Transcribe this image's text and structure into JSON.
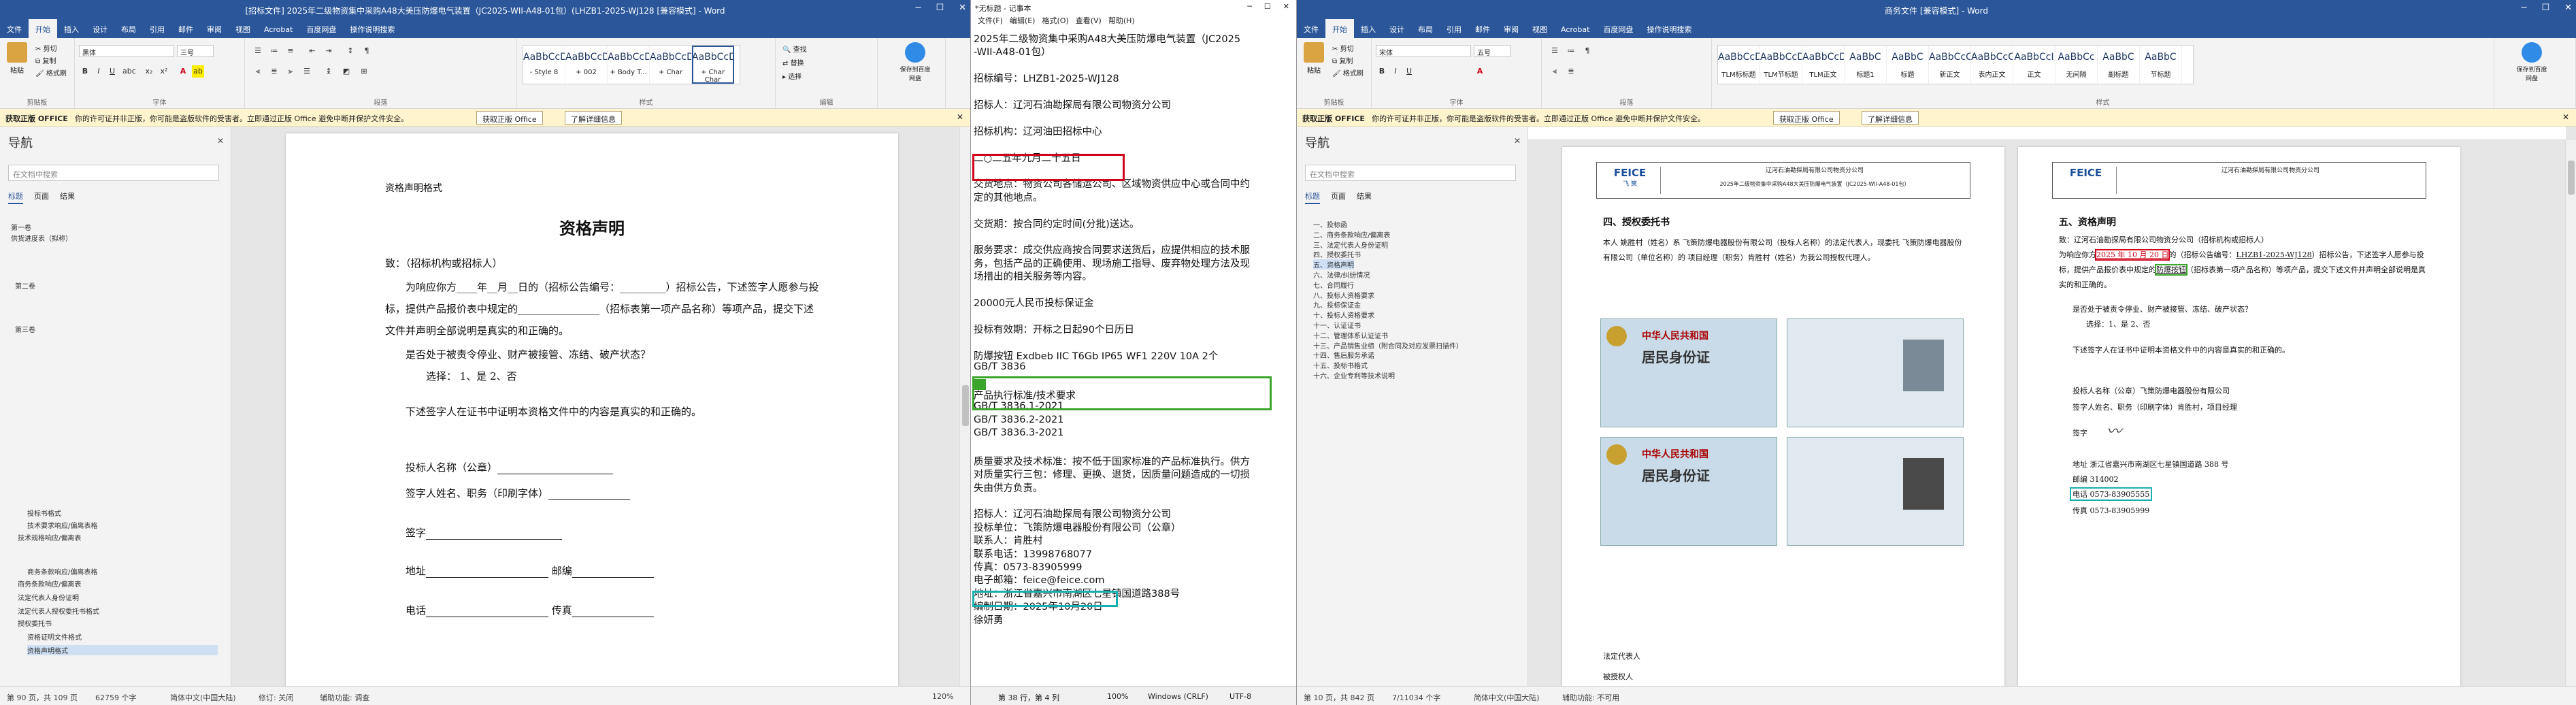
{
  "left_window": {
    "title": "[招标文件] 2025年二级物资集中采购A48大美压防爆电气装置（JC2025-WII-A48-01包）(LHZB1-2025-WJ128 [兼容模式] - Word",
    "tabs": [
      "文件",
      "开始",
      "插入",
      "设计",
      "布局",
      "引用",
      "邮件",
      "审阅",
      "视图",
      "Acrobat",
      "百度网盘",
      "操作说明搜索"
    ],
    "active_tab": "开始",
    "ribbon": {
      "paste": "粘贴",
      "cut": "剪切",
      "copy": "复制",
      "format_painter": "格式刷",
      "clipboard_group": "剪贴板",
      "font_name": "黑体",
      "font_size": "三号",
      "font_group": "字体",
      "paragraph_group": "段落",
      "styles_group": "样式",
      "styles": [
        {
          "preview": "AaBbCcDd",
          "name": "- Style 8"
        },
        {
          "preview": "AaBbCcDd",
          "name": "+ 002"
        },
        {
          "preview": "AaBbCcDd",
          "name": "+ Body T..."
        },
        {
          "preview": "AaBbCcDd",
          "name": "+ Char"
        },
        {
          "preview": "AaBbCcDd",
          "name": "+ Char Char"
        }
      ],
      "find": "查找",
      "replace": "替换",
      "select": "选择",
      "editing_group": "编辑",
      "save_baidu": "保存到百度网盘",
      "save_group": "保存"
    },
    "infobar": {
      "title": "获取正版 OFFICE",
      "message": "你的许可证并非正版，你可能是盗版软件的受害者。立即通过正版 Office 避免中断并保护文件安全。",
      "btn1": "获取正版 Office",
      "btn2": "了解详细信息"
    },
    "nav": {
      "title": "导航",
      "search_placeholder": "在文档中搜索",
      "tabs": [
        "标题",
        "页面",
        "结果"
      ],
      "items": [
        "第一卷",
        "供货进度表（拟称）",
        "第二卷",
        "第三卷",
        "投标书格式",
        "技术要求响应/偏离表格",
        "技术规格响应/偏离表",
        "商务条款响应/偏离表格",
        "商务条款响应/偏离表",
        "法定代表人身份证明",
        "法定代表人授权委托书格式",
        "授权委托书",
        "资格证明文件格式",
        "资格声明格式"
      ]
    },
    "document": {
      "section_label": "资格声明格式",
      "heading": "资格声明",
      "salutation": "致：（招标机构或招标人）",
      "para1": "为响应你方____年__月__日的（招标公告编号：_________）招标公告，下述签字人愿参与投标，提供产品报价表中规定的________________（招标表第一项产品名称）等项产品，提交下述文件并声明全部说明是真实的和正确的。",
      "q1": "是否处于被责令停业、财产被接管、冻结、破产状态？",
      "q1_options": "选择：  1、是          2、否",
      "para2": "下述签字人在证书中证明本资格文件中的内容是真实的和正确的。",
      "f1": "投标人名称（公章）",
      "f2": "签字人姓名、职务（印刷字体）",
      "f3": "签字",
      "f4": "地址",
      "f4b": "邮编",
      "f5": "电话",
      "f5b": "传真"
    },
    "status": {
      "page": "第 90 页，共 109 页",
      "words": "62759 个字",
      "lang": "简体中文(中国大陆)",
      "modify": "修订: 关闭",
      "a11y": "辅助功能: 调查",
      "zoom": "120%"
    }
  },
  "notepad": {
    "title": "*无标题 - 记事本",
    "menu": [
      "文件(F)",
      "编辑(E)",
      "格式(O)",
      "查看(V)",
      "帮助(H)"
    ],
    "lines": [
      "2025年二级物资集中采购A48大美压防爆电气装置（JC2025",
      "-WII-A48-01包）",
      "",
      "招标编号：LHZB1-2025-WJ128",
      "",
      "招标人：辽河石油勘探局有限公司物资分公司",
      "",
      "招标机构：辽河油田招标中心",
      "",
      "二○二五年九月二十五日",
      "",
      "交货地点：物资公司各储运公司、区域物资供应中心或合同中约",
      "定的其他地点。",
      "",
      "交货期：按合同约定时间(分批)送达。",
      "",
      "服务要求：成交供应商按合同要求送货后，应提供相应的技术服",
      "务，包括产品的正确使用、现场施工指导、废弃物处理方法及现",
      "场措出的相关服务等内容。",
      "",
      "20000元人民币投标保证金",
      "",
      "投标有效期：开标之日起90个日历日",
      "",
      "    防爆按钮 Exdbeb IIC T6Gb IP65 WF1 220V 10A 2个",
      "GB/T 3836",
      "",
      "产品执行标准/技术要求",
      "GB/T 3836.1-2021",
      "GB/T 3836.2-2021",
      "GB/T 3836.3-2021",
      "",
      "质量要求及技术标准：按不低于国家标准的产品标准执行。供方",
      "对质量实行三包：修理、更换、退货，因质量问题造成的一切损",
      "失由供方负责。",
      "",
      "招标人：辽河石油勘探局有限公司物资分公司",
      "投标单位：飞策防爆电器股份有限公司（公章）",
      "联系人：肯胜村",
      "联系电话：13998768077",
      "传真：0573-83905999",
      "电子邮箱：feice@feice.com",
      "地址：浙江省嘉兴市南湖区七星镇国道路388号",
      "编制日期：2025年10月20日",
      "徐妍勇"
    ],
    "status": {
      "pos": "第 38 行，第 4 列",
      "zoom": "100%",
      "eol": "Windows (CRLF)",
      "enc": "UTF-8"
    }
  },
  "right_window": {
    "title": "商务文件 [兼容模式] - Word",
    "tabs": [
      "文件",
      "开始",
      "插入",
      "设计",
      "布局",
      "引用",
      "邮件",
      "审阅",
      "视图",
      "Acrobat",
      "百度网盘",
      "操作说明搜索"
    ],
    "active_tab": "开始",
    "ribbon": {
      "font_name": "宋体",
      "font_size": "五号",
      "styles": [
        {
          "preview": "AaBbCcDd",
          "name": "TLM标标题"
        },
        {
          "preview": "AaBbCcDd",
          "name": "TLM节标题"
        },
        {
          "preview": "AaBbCcDd",
          "name": "TLM正文"
        },
        {
          "preview": "AaBbC",
          "name": "标题1"
        },
        {
          "preview": "AaBbC",
          "name": "标题"
        },
        {
          "preview": "AaBbCcC",
          "name": "新正文"
        },
        {
          "preview": "AaBbCcC",
          "name": "表内正文"
        },
        {
          "preview": "AaBbCcI",
          "name": "正文"
        },
        {
          "preview": "AaBbCc",
          "name": "无间隔"
        },
        {
          "preview": "AaBbC",
          "name": "副标题"
        },
        {
          "preview": "AaBbC",
          "name": "节标题"
        }
      ]
    },
    "nav": {
      "title": "导航",
      "search_placeholder": "在文档中搜索",
      "tabs": [
        "标题",
        "页面",
        "结果"
      ],
      "items": [
        "一、投标函",
        "二、商务条款响应/偏离表",
        "三、法定代表人身份证明",
        "四、授权委托书",
        "五、资格声明",
        "六、法律/纠纷情况",
        "七、合同履行",
        "八、投标人资格要求",
        "九、投标保证金",
        "十、投标人资格要求",
        "十一、认证证书",
        "十二、管理体系认证证书",
        "十三、产品销售业绩（附合同及对应发票扫描件）",
        "十四、售后服务承诺",
        "十五、投标书格式",
        "十六、企业专利等技术说明"
      ]
    },
    "page_left": {
      "company_header": "辽河石油勘探局有限公司物资分公司",
      "project": "2025年二级物资集中采购A48大美压防爆电气装置（JC2025-WII-A48-01包）",
      "logo": "FEICE",
      "logo_sub": "飞 策",
      "heading": "四、授权委托书",
      "body": "本人 姚胜村（姓名）系 飞策防爆电器股份有限公司（投标人名称）的法定代表人，现委托 飞策防爆电器股份有限公司（单位名称）的 项目经理（职务）肯胜村（姓名）为我公司授权代理人。",
      "agent_sign": "法定代表人",
      "agent_sign2": "被授权人",
      "id_title": "中华人民共和国",
      "id_name": "居民身份证"
    },
    "page_right": {
      "company_header": "辽河石油勘探局有限公司物资分公司",
      "logo": "FEICE",
      "heading": "五、资格声明",
      "salutation": "致：辽河石油勘探局有限公司物资分公司（招标机构或招标人）",
      "para1a": "为响应你方",
      "date_hl": "2025 年 10 月 20 日",
      "para1b": "的（招标公告编号：",
      "code": "LHZB1-2025-WJ128",
      "para1c": "）招标公告，下述签字人愿参与投标，提供产品报价表中规定的",
      "product_hl": "防爆按钮",
      "para1d": "（招标表第一项产品名称）等项产品，提交下述文件并声明全部说明是真实的和正确的。",
      "q1": "是否处于被责令停业、财产被接管、冻结、破产状态？",
      "q1_options": "选择：1、是  2、否",
      "para2": "下述签字人在证书中证明本资格文件中的内容是真实的和正确的。",
      "f1": "投标人名称（公章）飞策防爆电器股份有限公司",
      "f2": "签字人姓名、职务（印刷字体）肯胜村，项目经理",
      "f3": "签字",
      "f4": "地址  浙江省嘉兴市南湖区七星镇国道路 388 号",
      "f4b": "邮编  314002",
      "f5": "电话  0573-83905555",
      "f5b": "传真  0573-83905999"
    },
    "status": {
      "page": "第 10 页，共 842 页",
      "words": "7/11034 个字",
      "lang": "简体中文(中国大陆)",
      "a11y": "辅助功能: 不可用"
    }
  },
  "colors": {
    "word_blue": "#2b579a",
    "highlight_red": "#d0021b",
    "highlight_green": "#3aa52a",
    "highlight_cyan": "#17b0b0"
  }
}
